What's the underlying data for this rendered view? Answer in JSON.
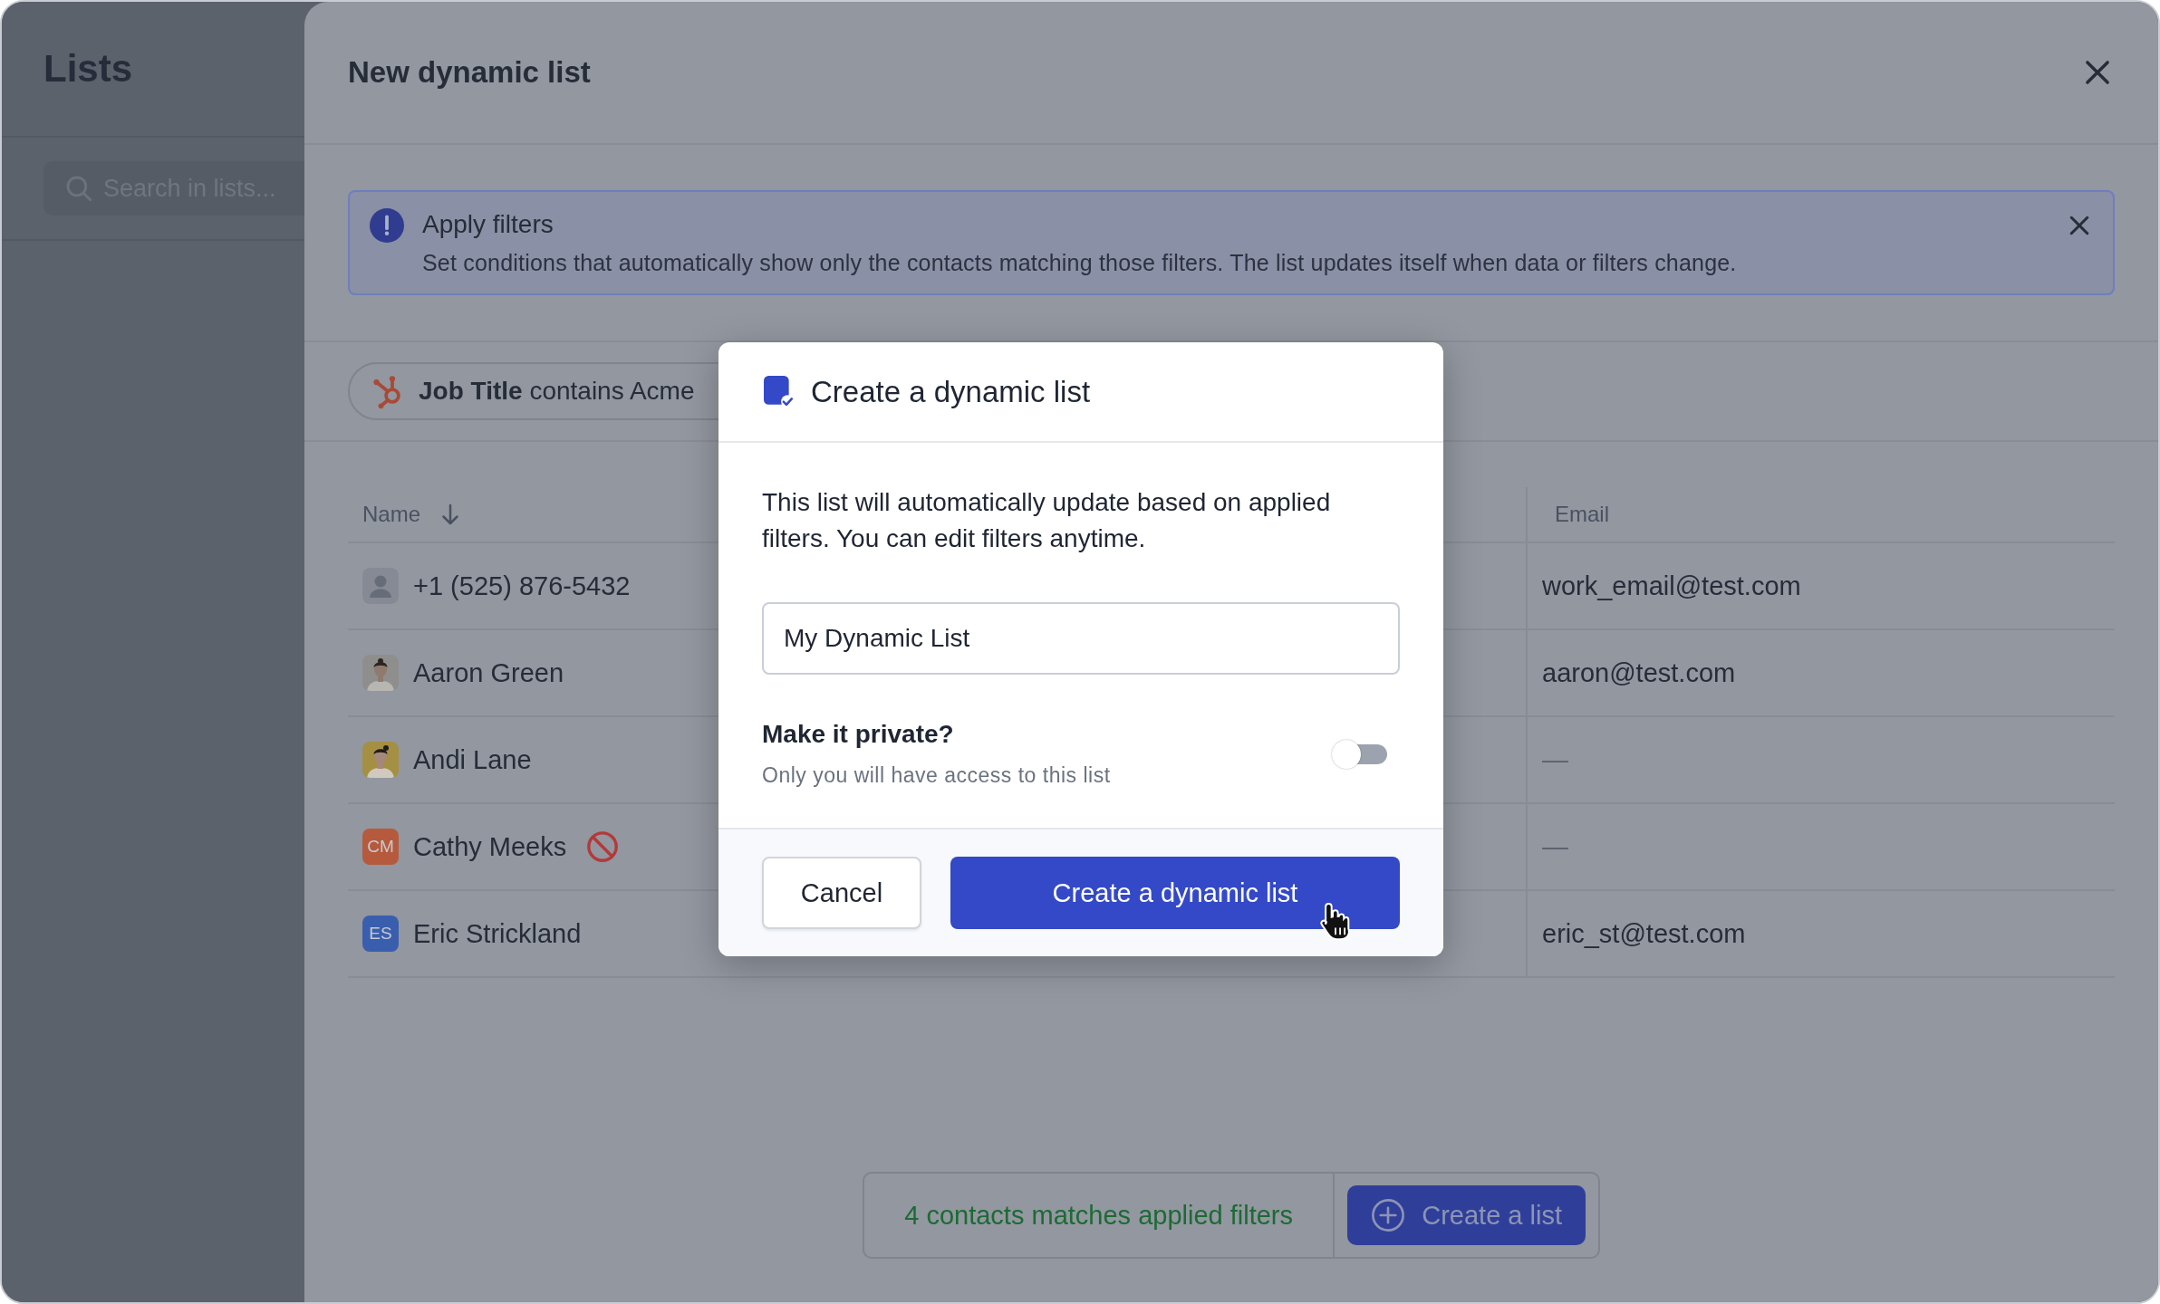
{
  "sidebar": {
    "title": "Lists",
    "search": {
      "placeholder": "Search in lists..."
    }
  },
  "panel": {
    "title": "New dynamic list",
    "alert": {
      "title": "Apply filters",
      "text": "Set conditions that automatically show only the contacts matching those filters. The list updates itself when data or filters change."
    },
    "filters": [
      {
        "text": "**Job Title** contains Acme"
      }
    ],
    "table": {
      "columns": [
        {
          "label": "Name",
          "sorted": true
        },
        {
          "label": "Email",
          "sorted": false
        }
      ],
      "rows": [
        {
          "name": "+1 (525) 876-5432",
          "avatar": {
            "kind": "placeholder"
          },
          "blocked": false,
          "email": "work_email@test.com"
        },
        {
          "name": "Aaron Green",
          "blocked": false,
          "email": "aaron@test.com"
        },
        {
          "name": "Andi Lane",
          "blocked": false,
          "email": "—"
        },
        {
          "name": "Cathy Meeks",
          "avatar": {
            "kind": "initials",
            "text": "CM",
            "color": "#b65a3d"
          },
          "blocked": true,
          "email": "—"
        },
        {
          "name": "Eric Strickland",
          "avatar": {
            "kind": "initials",
            "text": "ES",
            "color": "#3a5eae"
          },
          "blocked": false,
          "email": "eric_st@test.com"
        }
      ]
    },
    "summary": {
      "text": "4 contacts matches applied filters",
      "button": "Create a list"
    }
  },
  "dialog": {
    "title": "Create a dynamic list",
    "text": "This list will automatically update based on applied filters. You can edit filters anytime.",
    "name_field": {
      "value": "My Dynamic List"
    },
    "private": {
      "label": "Make it private?",
      "hint": "Only you will have access to this list",
      "on": false
    },
    "buttons": [
      {
        "label": "Cancel",
        "kind": "secondary"
      },
      {
        "label": "Create a dynamic list",
        "kind": "primary"
      }
    ]
  }
}
